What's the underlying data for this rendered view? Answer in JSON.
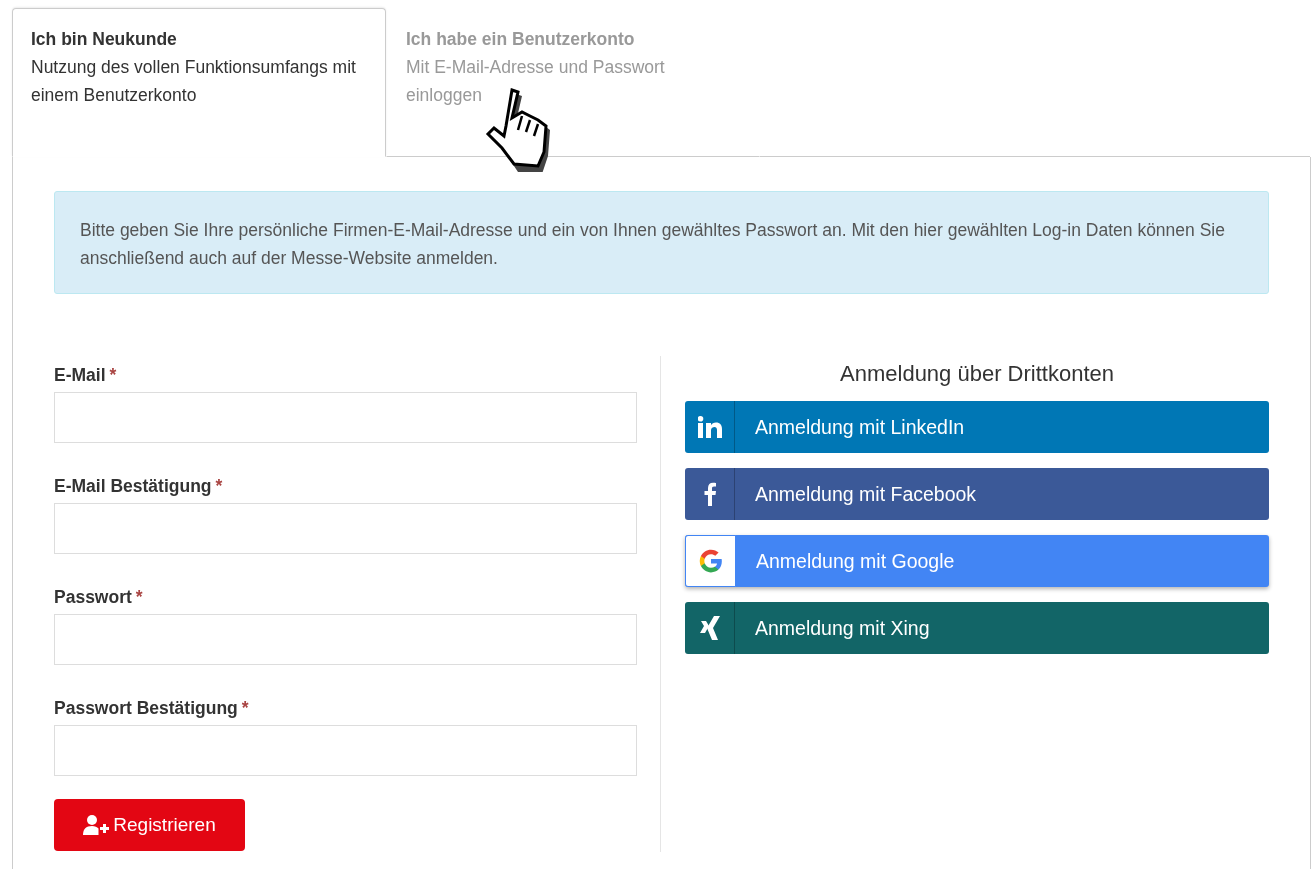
{
  "tabs": [
    {
      "title": "Ich bin Neukunde",
      "description": "Nutzung des vollen Funktionsumfangs mit einem Benutzerkonto",
      "selected": true
    },
    {
      "title": "Ich habe ein Benutzerkonto",
      "description": "Mit E-Mail-Adresse und Passwort einloggen",
      "selected": false
    }
  ],
  "info": "Bitte geben Sie Ihre persönliche Firmen-E-Mail-Adresse und ein von Ihnen gewähltes Passwort an. Mit den hier gewählten Log-in Daten können Sie anschließend auch auf der Messe-Website anmelden.",
  "form": {
    "fields": [
      {
        "label": "E-Mail",
        "required_mark": "*"
      },
      {
        "label": "E-Mail Bestätigung",
        "required_mark": "*"
      },
      {
        "label": "Passwort",
        "required_mark": "*"
      },
      {
        "label": "Passwort Bestätigung",
        "required_mark": "*"
      }
    ],
    "submit": "Registrieren"
  },
  "social": {
    "heading": "Anmeldung über Drittkonten",
    "providers": [
      {
        "kind": "linkedin",
        "label": "Anmeldung mit LinkedIn",
        "color": "#0077b5"
      },
      {
        "kind": "facebook",
        "label": "Anmeldung mit Facebook",
        "color": "#3b5998"
      },
      {
        "kind": "google",
        "label": "Anmeldung mit Google",
        "color": "#4285f4"
      },
      {
        "kind": "xing",
        "label": "Anmeldung mit Xing",
        "color": "#126567"
      }
    ]
  }
}
